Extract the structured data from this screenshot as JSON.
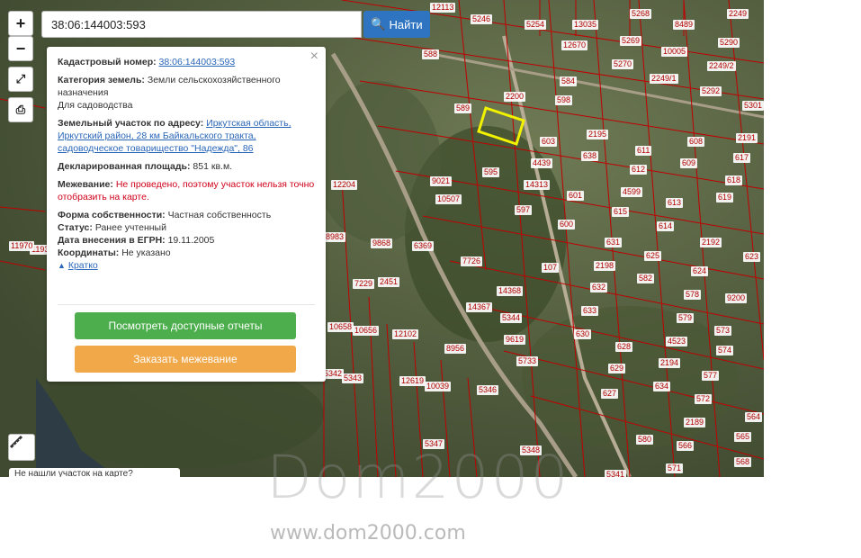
{
  "search": {
    "value": "38:06:144003:593",
    "button_label": "Найти"
  },
  "controls": {
    "zoom_in": "+",
    "zoom_out": "−"
  },
  "info": {
    "cadastral_label": "Кадастровый номер:",
    "cadastral_value": "38:06:144003:593",
    "category_label": "Категория земель:",
    "category_value": "Земли сельскохозяйственного назначения",
    "usage_value": "Для садоводства",
    "address_label": "Земельный участок по адресу:",
    "address_value": "Иркутская область, Иркутский район, 28 км Байкальского тракта, садоводческое товарищество \"Надежда\", 86",
    "area_label": "Декларированная площадь:",
    "area_value": "851 кв.м.",
    "survey_label": "Межевание:",
    "survey_value": "Не проведено, поэтому участок нельзя точно отобразить на карте.",
    "ownership_label": "Форма собственности:",
    "ownership_value": "Частная собственность",
    "status_label": "Статус:",
    "status_value": "Ранее учтенный",
    "egrn_label": "Дата внесения в ЕГРН:",
    "egrn_value": "19.11.2005",
    "coords_label": "Координаты:",
    "coords_value": "Не указано",
    "collapse_label": "Кратко",
    "reports_button": "Посмотреть доступные отчеты",
    "order_button": "Заказать межевание"
  },
  "hint": "Не нашли участок на карте?",
  "watermark": {
    "logo": "Dom2000",
    "url": "www.dom2000.com"
  },
  "colors": {
    "search_button": "#2f74c0",
    "reports_button": "#4cae4c",
    "order_button": "#f0a848",
    "parcel_border": "#c00000",
    "highlight": "#f2f200"
  },
  "parcels": [
    "12113",
    "5246",
    "5254",
    "13035",
    "5268",
    "8489",
    "2249",
    "588",
    "12670",
    "5269",
    "10005",
    "5290",
    "2249/2",
    "589",
    "2200",
    "584",
    "5270",
    "2249/1",
    "5292",
    "5301",
    "598",
    "603",
    "2195",
    "611",
    "608",
    "2191",
    "4439",
    "638",
    "609",
    "617",
    "595",
    "9021",
    "14313",
    "612",
    "618",
    "10507",
    "601",
    "4599",
    "613",
    "12204",
    "597",
    "600",
    "615",
    "614",
    "619",
    "8983",
    "6369",
    "9868",
    "7726",
    "631",
    "2192",
    "623",
    "11932",
    "11970",
    "2198",
    "625",
    "624",
    "9200",
    "7229",
    "2451",
    "14367",
    "14368",
    "107",
    "632",
    "582",
    "578",
    "12102",
    "5344",
    "9619",
    "633",
    "579",
    "573",
    "10658",
    "10656",
    "8956",
    "630",
    "628",
    "4523",
    "574",
    "5733",
    "12619",
    "10039",
    "5346",
    "629",
    "2194",
    "577",
    "5342",
    "5343",
    "627",
    "634",
    "572",
    "564",
    "580",
    "566",
    "565",
    "5347",
    "5348",
    "5341",
    "571",
    "568",
    "2189"
  ]
}
